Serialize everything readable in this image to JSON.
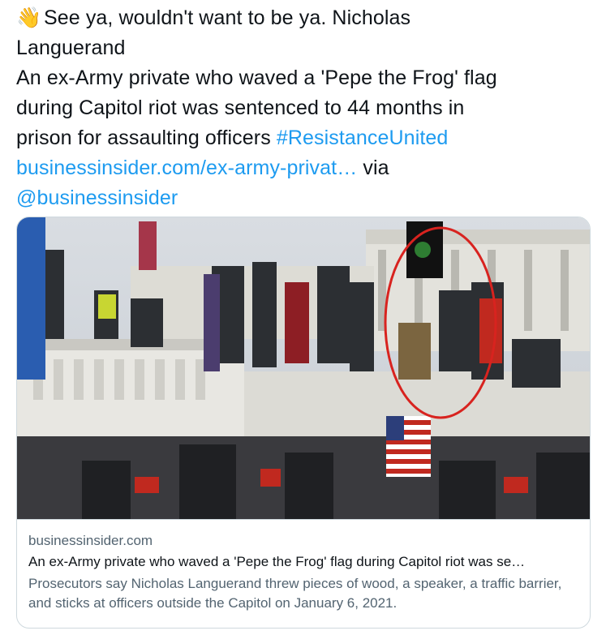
{
  "tweet": {
    "emoji": "👋",
    "line1": "See ya, wouldn't want to be ya. Nicholas",
    "line2": "Languerand",
    "line3": "An ex-Army private who waved a 'Pepe the Frog' flag",
    "line4": "during Capitol riot was sentenced to 44 months in",
    "line5_text": "prison for assaulting officers ",
    "hashtag": "#ResistanceUnited",
    "url": "businessinsider.com/ex-army-privat…",
    "via": " via",
    "mention": "@businessinsider"
  },
  "card": {
    "image_label": "Photo of crowd at the Capitol with flags, one person circled in red",
    "domain": "businessinsider.com",
    "headline": "An ex-Army private who waved a 'Pepe the Frog' flag during Capitol riot was se…",
    "description": "Prosecutors say Nicholas Languerand threw pieces of wood, a speaker, a traffic barrier, and sticks at officers outside the Capitol on January 6, 2021."
  },
  "colors": {
    "link": "#1d9bf0",
    "text": "#0f1419",
    "muted": "#536471",
    "border": "#cfd9de",
    "circle": "#d8231f"
  }
}
